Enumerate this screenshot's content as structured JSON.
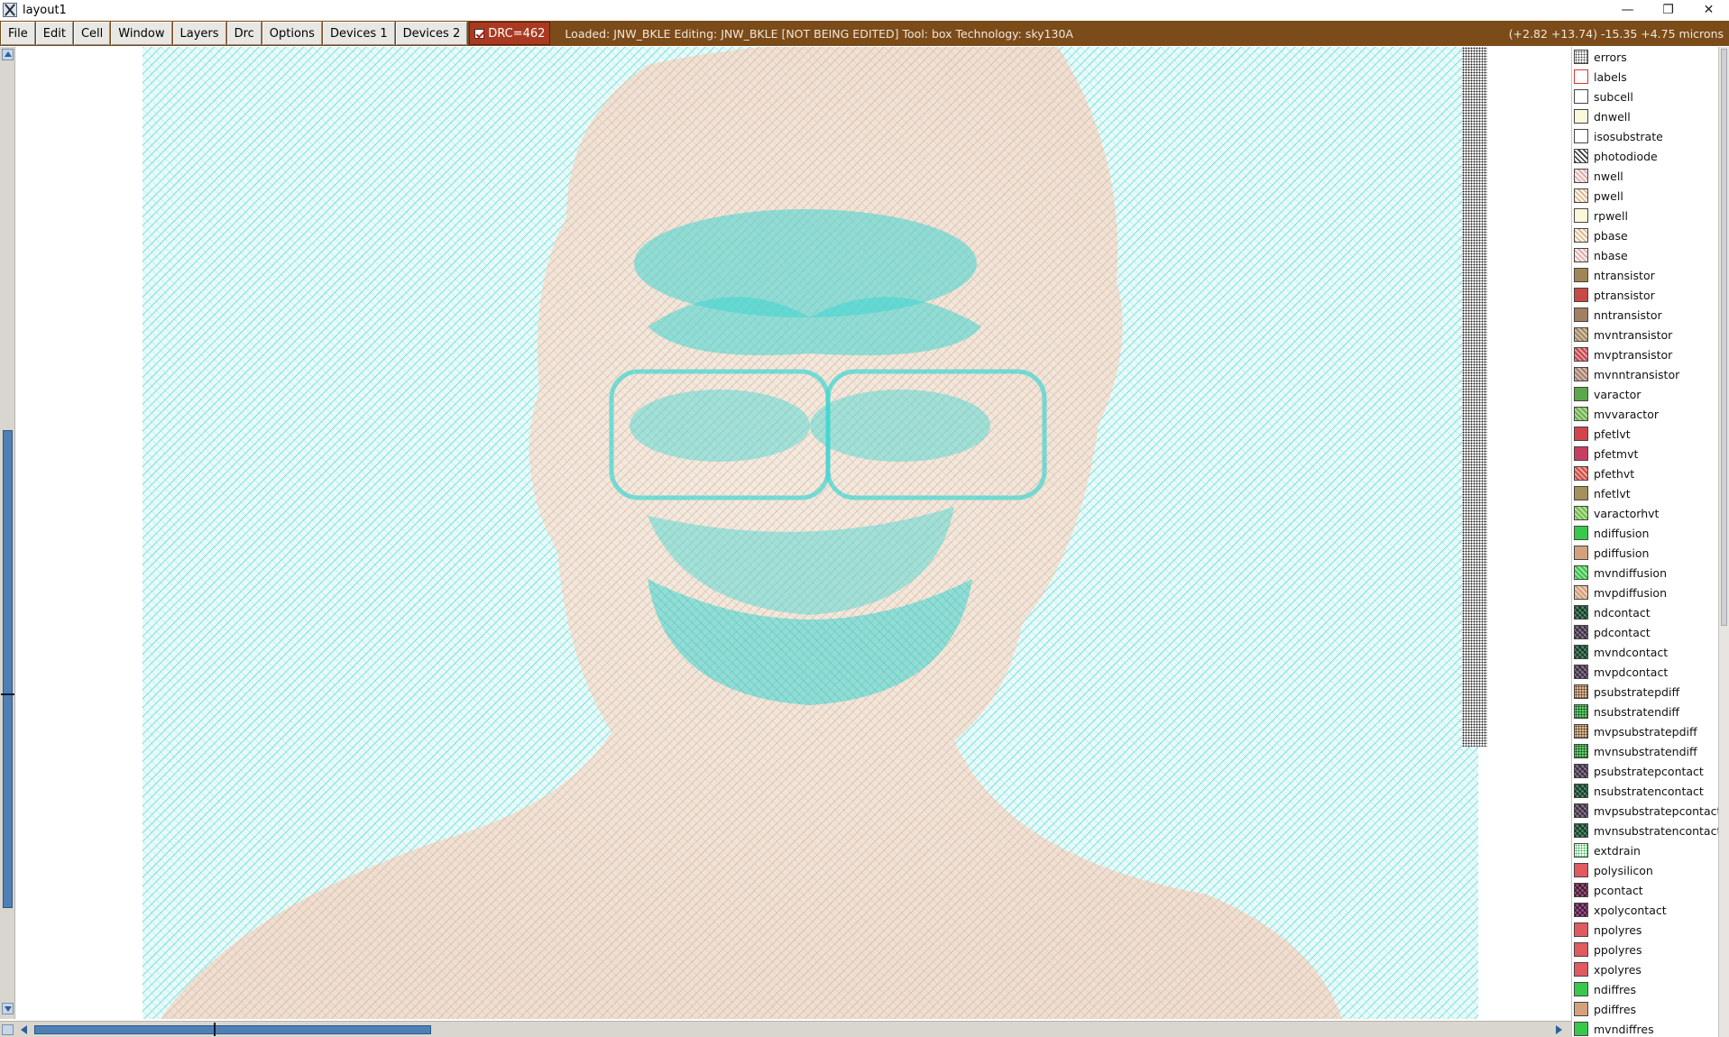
{
  "window": {
    "title": "layout1",
    "controls": {
      "minimize": "—",
      "maximize": "❐",
      "close": "✕"
    }
  },
  "menu": {
    "items": [
      "File",
      "Edit",
      "Cell",
      "Window",
      "Layers",
      "Drc",
      "Options",
      "Devices 1",
      "Devices 2"
    ],
    "drc_label": "DRC=462",
    "status": "Loaded: JNW_BKLE Editing: JNW_BKLE [NOT BEING EDITED] Tool: box  Technology: sky130A",
    "coords": "(+2.82 +13.74) -15.35 +4.75 microns"
  },
  "colors": {
    "menubar": "#7b4b1a",
    "drc_bg": "#a93a21",
    "canvas_hatch": "#3fd6d2",
    "canvas_bg": "#e7f8f5",
    "pdiff_hatch": "#d4a27a",
    "scroll_thumb": "#4f7fb5"
  },
  "layers": [
    {
      "name": "errors",
      "color": "#ffffff",
      "pattern": "dots"
    },
    {
      "name": "labels",
      "color": "#ffffff",
      "pattern": "outline-red"
    },
    {
      "name": "subcell",
      "color": "#ffffff",
      "pattern": "outline"
    },
    {
      "name": "dnwell",
      "color": "#fbf9dc",
      "pattern": "none"
    },
    {
      "name": "isosubstrate",
      "color": "#ffffff",
      "pattern": "none"
    },
    {
      "name": "photodiode",
      "color": "#ffffff",
      "pattern": "diag-dark"
    },
    {
      "name": "nwell",
      "color": "#fbe9ea",
      "pattern": "diag-light"
    },
    {
      "name": "pwell",
      "color": "#fbf7d9",
      "pattern": "diag-light"
    },
    {
      "name": "rpwell",
      "color": "#fbf7d9",
      "pattern": "none"
    },
    {
      "name": "pbase",
      "color": "#fbf7d9",
      "pattern": "diag-light"
    },
    {
      "name": "nbase",
      "color": "#fbe9ea",
      "pattern": "diag-light"
    },
    {
      "name": "ntransistor",
      "color": "#a08656",
      "pattern": "none"
    },
    {
      "name": "ptransistor",
      "color": "#c84a46",
      "pattern": "none"
    },
    {
      "name": "nntransistor",
      "color": "#a07f62",
      "pattern": "none"
    },
    {
      "name": "mvntransistor",
      "color": "#a58b60",
      "pattern": "diag"
    },
    {
      "name": "mvptransistor",
      "color": "#c84a50",
      "pattern": "diag"
    },
    {
      "name": "mvnntransistor",
      "color": "#a98170",
      "pattern": "diag"
    },
    {
      "name": "varactor",
      "color": "#5ba84a",
      "pattern": "none"
    },
    {
      "name": "mvvaractor",
      "color": "#6db34e",
      "pattern": "diag"
    },
    {
      "name": "pfetlvt",
      "color": "#d0464c",
      "pattern": "none"
    },
    {
      "name": "pfetmvt",
      "color": "#c83e62",
      "pattern": "none"
    },
    {
      "name": "pfethvt",
      "color": "#d5524a",
      "pattern": "diag"
    },
    {
      "name": "nfetlvt",
      "color": "#a5905e",
      "pattern": "none"
    },
    {
      "name": "varactorhvt",
      "color": "#76c04e",
      "pattern": "diag"
    },
    {
      "name": "ndiffusion",
      "color": "#37c94c",
      "pattern": "none"
    },
    {
      "name": "pdiffusion",
      "color": "#d3a27c",
      "pattern": "none"
    },
    {
      "name": "mvndiffusion",
      "color": "#3fc550",
      "pattern": "diag"
    },
    {
      "name": "mvpdiffusion",
      "color": "#d3a27c",
      "pattern": "diag"
    },
    {
      "name": "ndcontact",
      "color": "#2b6b4a",
      "pattern": "cross"
    },
    {
      "name": "pdcontact",
      "color": "#6a5470",
      "pattern": "cross"
    },
    {
      "name": "mvndcontact",
      "color": "#2b6b4a",
      "pattern": "cross"
    },
    {
      "name": "mvpdcontact",
      "color": "#6a5470",
      "pattern": "cross"
    },
    {
      "name": "psubstratepdiff",
      "color": "#e0b48c",
      "pattern": "dots"
    },
    {
      "name": "nsubstratendiff",
      "color": "#5ccf65",
      "pattern": "dots"
    },
    {
      "name": "mvpsubstratepdiff",
      "color": "#e0b48c",
      "pattern": "dots"
    },
    {
      "name": "mvnsubstratendiff",
      "color": "#5ccf65",
      "pattern": "dots"
    },
    {
      "name": "psubstratepcontact",
      "color": "#6a5470",
      "pattern": "cross"
    },
    {
      "name": "nsubstratencontact",
      "color": "#2b6b4a",
      "pattern": "cross"
    },
    {
      "name": "mvpsubstratepcontact",
      "color": "#6a5470",
      "pattern": "cross"
    },
    {
      "name": "mvnsubstratencontact",
      "color": "#2b6b4a",
      "pattern": "cross"
    },
    {
      "name": "extdrain",
      "color": "#ffffff",
      "pattern": "dots-green"
    },
    {
      "name": "polysilicon",
      "color": "#e05a5f",
      "pattern": "none"
    },
    {
      "name": "pcontact",
      "color": "#7a2f5a",
      "pattern": "cross"
    },
    {
      "name": "xpolycontact",
      "color": "#7a2f6a",
      "pattern": "cross"
    },
    {
      "name": "npolyres",
      "color": "#e05a5f",
      "pattern": "none"
    },
    {
      "name": "ppolyres",
      "color": "#e05a5f",
      "pattern": "none"
    },
    {
      "name": "xpolyres",
      "color": "#e05a5f",
      "pattern": "none"
    },
    {
      "name": "ndiffres",
      "color": "#37c94c",
      "pattern": "none"
    },
    {
      "name": "pdiffres",
      "color": "#d3a27c",
      "pattern": "none"
    },
    {
      "name": "mvndiffres",
      "color": "#37c94c",
      "pattern": "none"
    }
  ]
}
